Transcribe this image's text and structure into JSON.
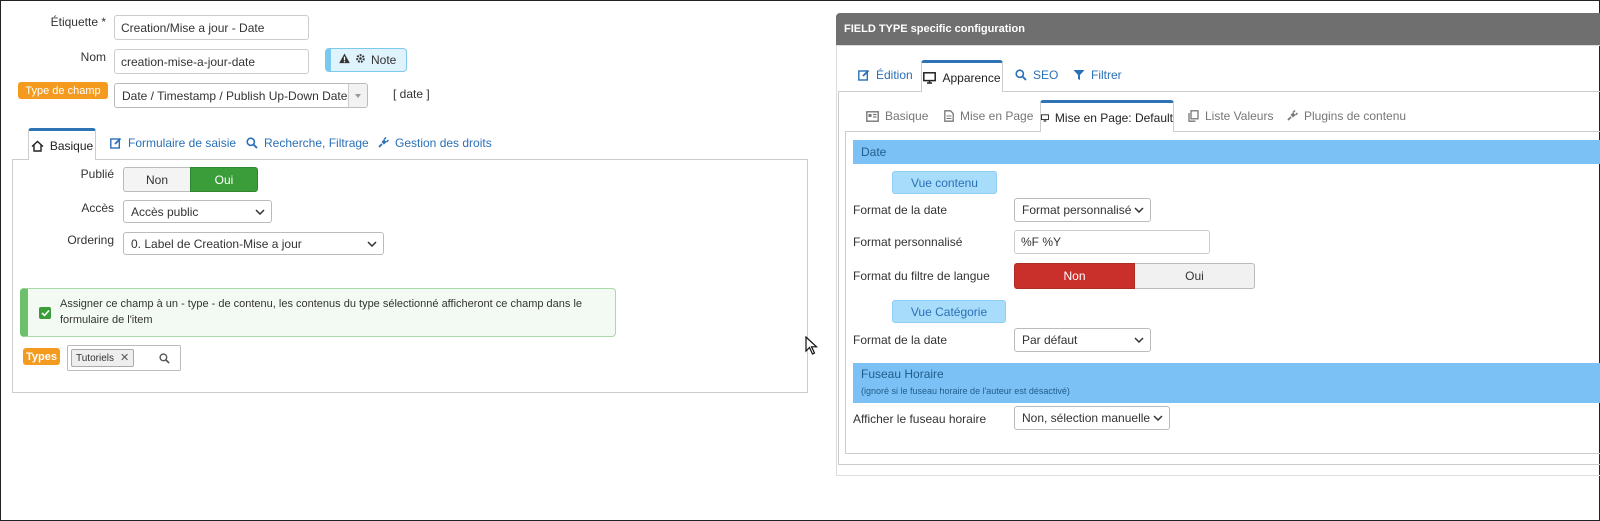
{
  "left": {
    "etiquette_label": "Étiquette *",
    "etiquette_value": "Creation/Mise a jour - Date",
    "nom_label": "Nom",
    "nom_value": "creation-mise-a-jour-date",
    "note_label": "Note",
    "type_badge": "Type de champ",
    "type_value": "Date / Timestamp / Publish Up-Down Dates",
    "type_code": "[ date ]",
    "tabs": [
      {
        "label": "Basique",
        "icon": "home-icon"
      },
      {
        "label": "Formulaire de saisie",
        "icon": "edit-icon"
      },
      {
        "label": "Recherche, Filtrage",
        "icon": "search-icon"
      },
      {
        "label": "Gestion des droits",
        "icon": "plug-icon"
      }
    ],
    "publie_label": "Publié",
    "publie_off": "Non",
    "publie_on": "Oui",
    "acces_label": "Accès",
    "acces_value": "Accès public",
    "ordering_label": "Ordering",
    "ordering_value": "0. Label de Creation-Mise a jour",
    "assign_text": "Assigner ce champ à un - type - de contenu, les contenus du type sélectionné afficheront ce champ dans le formulaire de l'item",
    "types_badge": "Types",
    "types_tag": "Tutoriels",
    "colors": {
      "orange": "#f39a1f",
      "green": "#3a9d3a",
      "blue": "#2a6fb7"
    }
  },
  "right": {
    "header": "FIELD TYPE specific configuration",
    "tabs": [
      {
        "label": "Édition",
        "icon": "edit-icon"
      },
      {
        "label": "Apparence",
        "icon": "monitor-icon"
      },
      {
        "label": "SEO",
        "icon": "search-icon"
      },
      {
        "label": "Filtrer",
        "icon": "filter-icon"
      }
    ],
    "subtabs": [
      {
        "label": "Basique",
        "icon": "card-icon"
      },
      {
        "label": "Mise en Page",
        "icon": "document-icon"
      },
      {
        "label": "Mise en Page: Default",
        "icon": "monitor-icon"
      },
      {
        "label": "Liste Valeurs",
        "icon": "copy-icon"
      },
      {
        "label": "Plugins de contenu",
        "icon": "plug-icon"
      }
    ],
    "section_date": "Date",
    "vue_contenu": "Vue contenu",
    "format_date_label": "Format de la date",
    "format_date_value": "Format personnalisé",
    "format_perso_label": "Format personnalisé",
    "format_perso_value": "%F %Y",
    "filtre_langue_label": "Format du filtre de langue",
    "filtre_non": "Non",
    "filtre_oui": "Oui",
    "vue_categorie": "Vue Catégorie",
    "format_date2_label": "Format de la date",
    "format_date2_value": "Par défaut",
    "fuseau_title": "Fuseau Horaire",
    "fuseau_note": "(ignoré si le fuseau horaire de l'auteur est désactivé)",
    "afficher_fuseau_label": "Afficher le fuseau horaire",
    "afficher_fuseau_value": "Non, sélection manuelle",
    "colors": {
      "header_bg": "#6f6f6f",
      "red": "#c9302c",
      "section_blue": "#7cc1f5"
    }
  }
}
